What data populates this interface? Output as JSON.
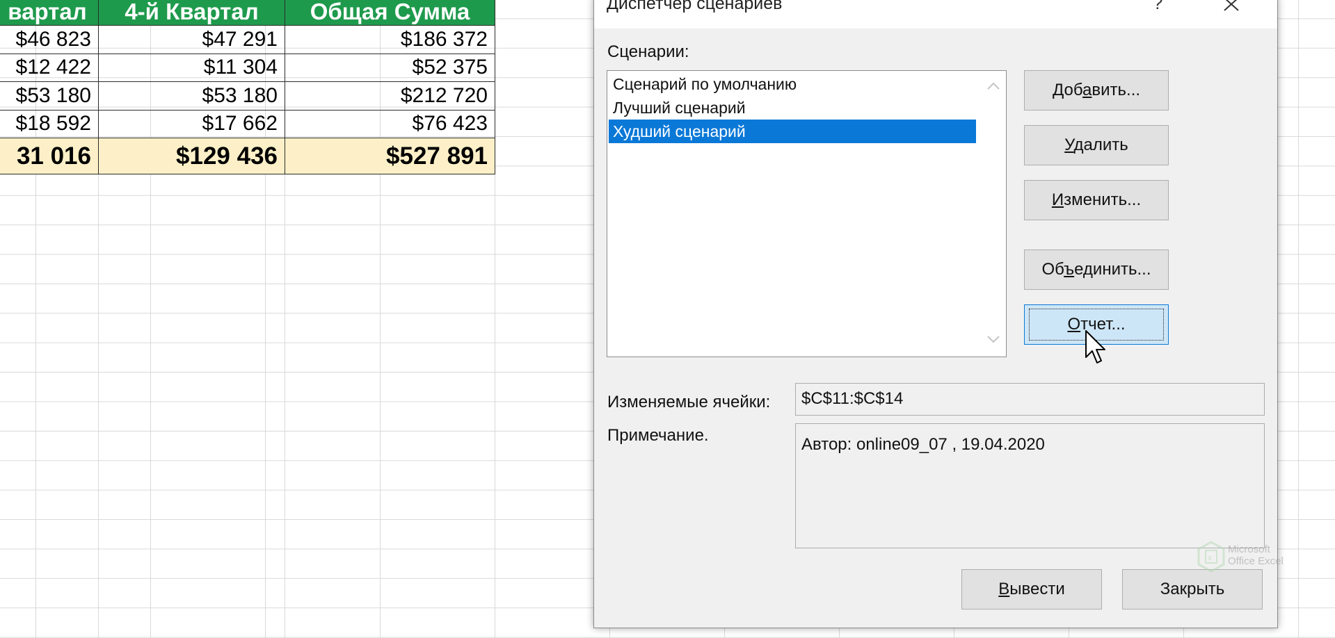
{
  "spreadsheet": {
    "headers": [
      "вартал",
      "4-й Квартал",
      "Общая Сумма"
    ],
    "rows": [
      [
        "$46 823",
        "$47 291",
        "$186 372"
      ],
      [
        "$12 422",
        "$11 304",
        "$52 375"
      ],
      [
        "$53 180",
        "$53 180",
        "$212 720"
      ],
      [
        "$18 592",
        "$17 662",
        "$76 423"
      ]
    ],
    "total": [
      "31 016",
      "$129 436",
      "$527 891"
    ],
    "header_color": "#1e9a4c",
    "total_color": "#fdf0c8"
  },
  "dialog": {
    "title": "Диспетчер сценариев",
    "help_label": "?",
    "scenarios_label": "Сценарии:",
    "scenarios": [
      "Сценарий по умолчанию",
      "Лучший сценарий",
      "Худший сценарий"
    ],
    "selected_index": 2,
    "buttons": {
      "add_pre": "Доб",
      "add_ul": "а",
      "add_post": "вить...",
      "delete_pre": "",
      "delete_ul": "У",
      "delete_post": "далить",
      "edit_pre": "",
      "edit_ul": "И",
      "edit_post": "зменить...",
      "merge_pre": "Об",
      "merge_ul": "ъ",
      "merge_post": "единить...",
      "report_pre": "",
      "report_ul": "О",
      "report_post": "тчет..."
    },
    "changing_cells_label": "Изменяемые ячейки:",
    "changing_cells_value": "$C$11:$C$14",
    "comment_label": "Примечание.",
    "comment_value": "Автор: online09_07 , 19.04.2020",
    "show_pre": "",
    "show_ul": "В",
    "show_post": "ывести",
    "close_label": "Закрыть",
    "selection_color": "#0a78d7"
  },
  "watermark": {
    "line1": "Microsoft",
    "line2": "Office Excel",
    "icon": "excel-logo-icon"
  }
}
